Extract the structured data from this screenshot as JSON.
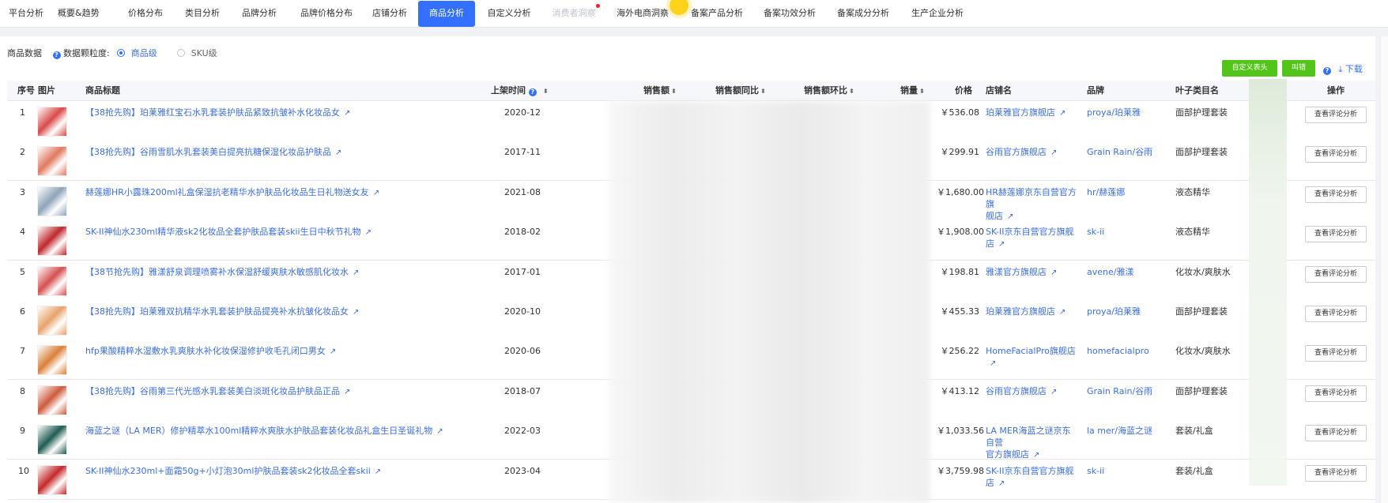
{
  "nav": {
    "tabs": [
      "平台分析",
      "概要&趋势",
      "价格分布",
      "类目分析",
      "品牌分析",
      "品牌价格分布",
      "店铺分析",
      "商品分析",
      "自定义分析",
      "消费者洞察",
      "海外电商洞察",
      "备案产品分析",
      "备案功效分析",
      "备案成分分析",
      "生产企业分析"
    ],
    "active_tab": "商品分析",
    "disabled_tab": "消费者洞察"
  },
  "panel": {
    "title": "商品数据",
    "granularity_label": "数据颗粒度:",
    "options": [
      "商品级",
      "SKU级"
    ],
    "selected_option": "商品级",
    "custom_header_btn": "自定义表头",
    "second_btn": "叫错",
    "download": "下载"
  },
  "table": {
    "headers": {
      "idx": "序号",
      "image": "图片",
      "title": "商品标题",
      "listed": "上架时间",
      "sales": "销售额",
      "sales_yoy": "销售额同比",
      "sales_mom": "销售额环比",
      "volume": "销量",
      "price": "价格",
      "shop": "店铺名",
      "brand": "品牌",
      "category": "叶子类目名",
      "ops": "操作"
    },
    "rows": [
      {
        "idx": "1",
        "title": "【38抢先购】珀莱雅红宝石水乳套装护肤品紧致抗皱补水化妆品女",
        "date": "2020-12",
        "price": "￥536.08",
        "shop": [
          "珀莱雅官方旗舰店"
        ],
        "brand": "proya/珀莱雅",
        "category": "面部护理套装",
        "op": "查看评论分析",
        "thumb_color": "#d94a4a"
      },
      {
        "idx": "2",
        "title": "【38抢先购】谷雨雪肌水乳套装美白提亮抗糖保湿化妆品护肤品",
        "date": "2017-11",
        "price": "￥299.91",
        "shop": [
          "谷雨官方旗舰店"
        ],
        "brand": "Grain Rain/谷雨",
        "category": "面部护理套装",
        "op": "查看评论分析",
        "thumb_color": "#e07a5f"
      },
      {
        "idx": "3",
        "title": "赫莲娜HR小露珠200ml礼盒保湿抗老精华水护肤品化妆品生日礼物送女友",
        "date": "2021-08",
        "price": "￥1,680.00",
        "shop": [
          "HR赫莲娜京东自营官方旗",
          "舰店"
        ],
        "brand": "hr/赫莲娜",
        "category": "液态精华",
        "op": "查看评论分析",
        "thumb_color": "#8fa3b8"
      },
      {
        "idx": "4",
        "title": "SK-II神仙水230ml精华液sk2化妆品全套护肤品套装skii生日中秋节礼物",
        "date": "2018-02",
        "price": "￥1,908.00",
        "shop": [
          "SK-II京东自营官方旗舰店"
        ],
        "brand": "sk-ii",
        "category": "液态精华",
        "op": "查看评论分析",
        "thumb_color": "#c0282d"
      },
      {
        "idx": "5",
        "title": "【38节抢先购】雅漾舒泉调理喷雾补水保湿舒缓爽肤水敏感肌化妆水",
        "date": "2017-01",
        "price": "￥198.81",
        "shop": [
          "雅漾官方旗舰店"
        ],
        "brand": "avene/雅漾",
        "category": "化妆水/爽肤水",
        "op": "查看评论分析",
        "thumb_color": "#d65050"
      },
      {
        "idx": "6",
        "title": "【38抢先购】珀莱雅双抗精华水乳套装护肤品提亮补水抗皱化妆品女",
        "date": "2020-10",
        "price": "￥455.33",
        "shop": [
          "珀莱雅官方旗舰店"
        ],
        "brand": "proya/珀莱雅",
        "category": "面部护理套装",
        "op": "查看评论分析",
        "thumb_color": "#e8a36b"
      },
      {
        "idx": "7",
        "title": "hfp果酸精粹水湿敷水乳爽肤水补化妆保湿修护收毛孔闭口男女",
        "date": "2020-06",
        "price": "￥256.22",
        "shop": [
          "HomeFacialPro旗舰店"
        ],
        "brand": "homefacialpro",
        "category": "化妆水/爽肤水",
        "op": "查看评论分析",
        "thumb_color": "#d9803a"
      },
      {
        "idx": "8",
        "title": "【38抢先购】谷雨第三代光感水乳套装美白淡斑化妆品护肤品正品",
        "date": "2018-07",
        "price": "￥413.12",
        "shop": [
          "谷雨官方旗舰店"
        ],
        "brand": "Grain Rain/谷雨",
        "category": "面部护理套装",
        "op": "查看评论分析",
        "thumb_color": "#cf5a3e"
      },
      {
        "idx": "9",
        "title": "海蓝之谜（LA MER）修护精萃水100ml精粹水爽肤水护肤品套装化妆品礼盒生日圣诞礼物",
        "date": "2022-03",
        "price": "￥1,033.56",
        "shop": [
          "LA MER海蓝之谜京东自营",
          "官方旗舰店"
        ],
        "brand": "la mer/海蓝之谜",
        "category": "套装/礼盒",
        "op": "查看评论分析",
        "thumb_color": "#1f5c52"
      },
      {
        "idx": "10",
        "title": "SK-II神仙水230ml+面霜50g+小灯泡30ml护肤品套装sk2化妆品全套skii",
        "date": "2023-04",
        "price": "￥3,759.98",
        "shop": [
          "SK-II京东自营官方旗舰店"
        ],
        "brand": "sk-ii",
        "category": "套装/礼盒",
        "op": "查看评论分析",
        "thumb_color": "#c42a2a"
      }
    ]
  }
}
